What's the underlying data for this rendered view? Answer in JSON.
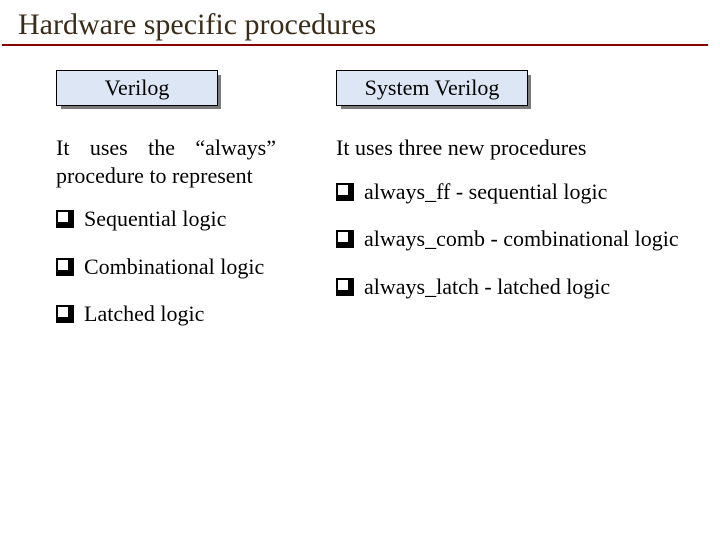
{
  "title": "Hardware specific procedures",
  "left": {
    "label": "Verilog",
    "intro_line1": "It uses the “always”",
    "intro_line2": "procedure to represent",
    "bullets": [
      "Sequential logic",
      "Combinational logic",
      "Latched logic"
    ]
  },
  "right": {
    "label": "System Verilog",
    "intro": "It uses three new procedures",
    "bullets": [
      "always_ff - sequential logic",
      "always_comb - combinational logic",
      "always_latch - latched logic"
    ]
  }
}
